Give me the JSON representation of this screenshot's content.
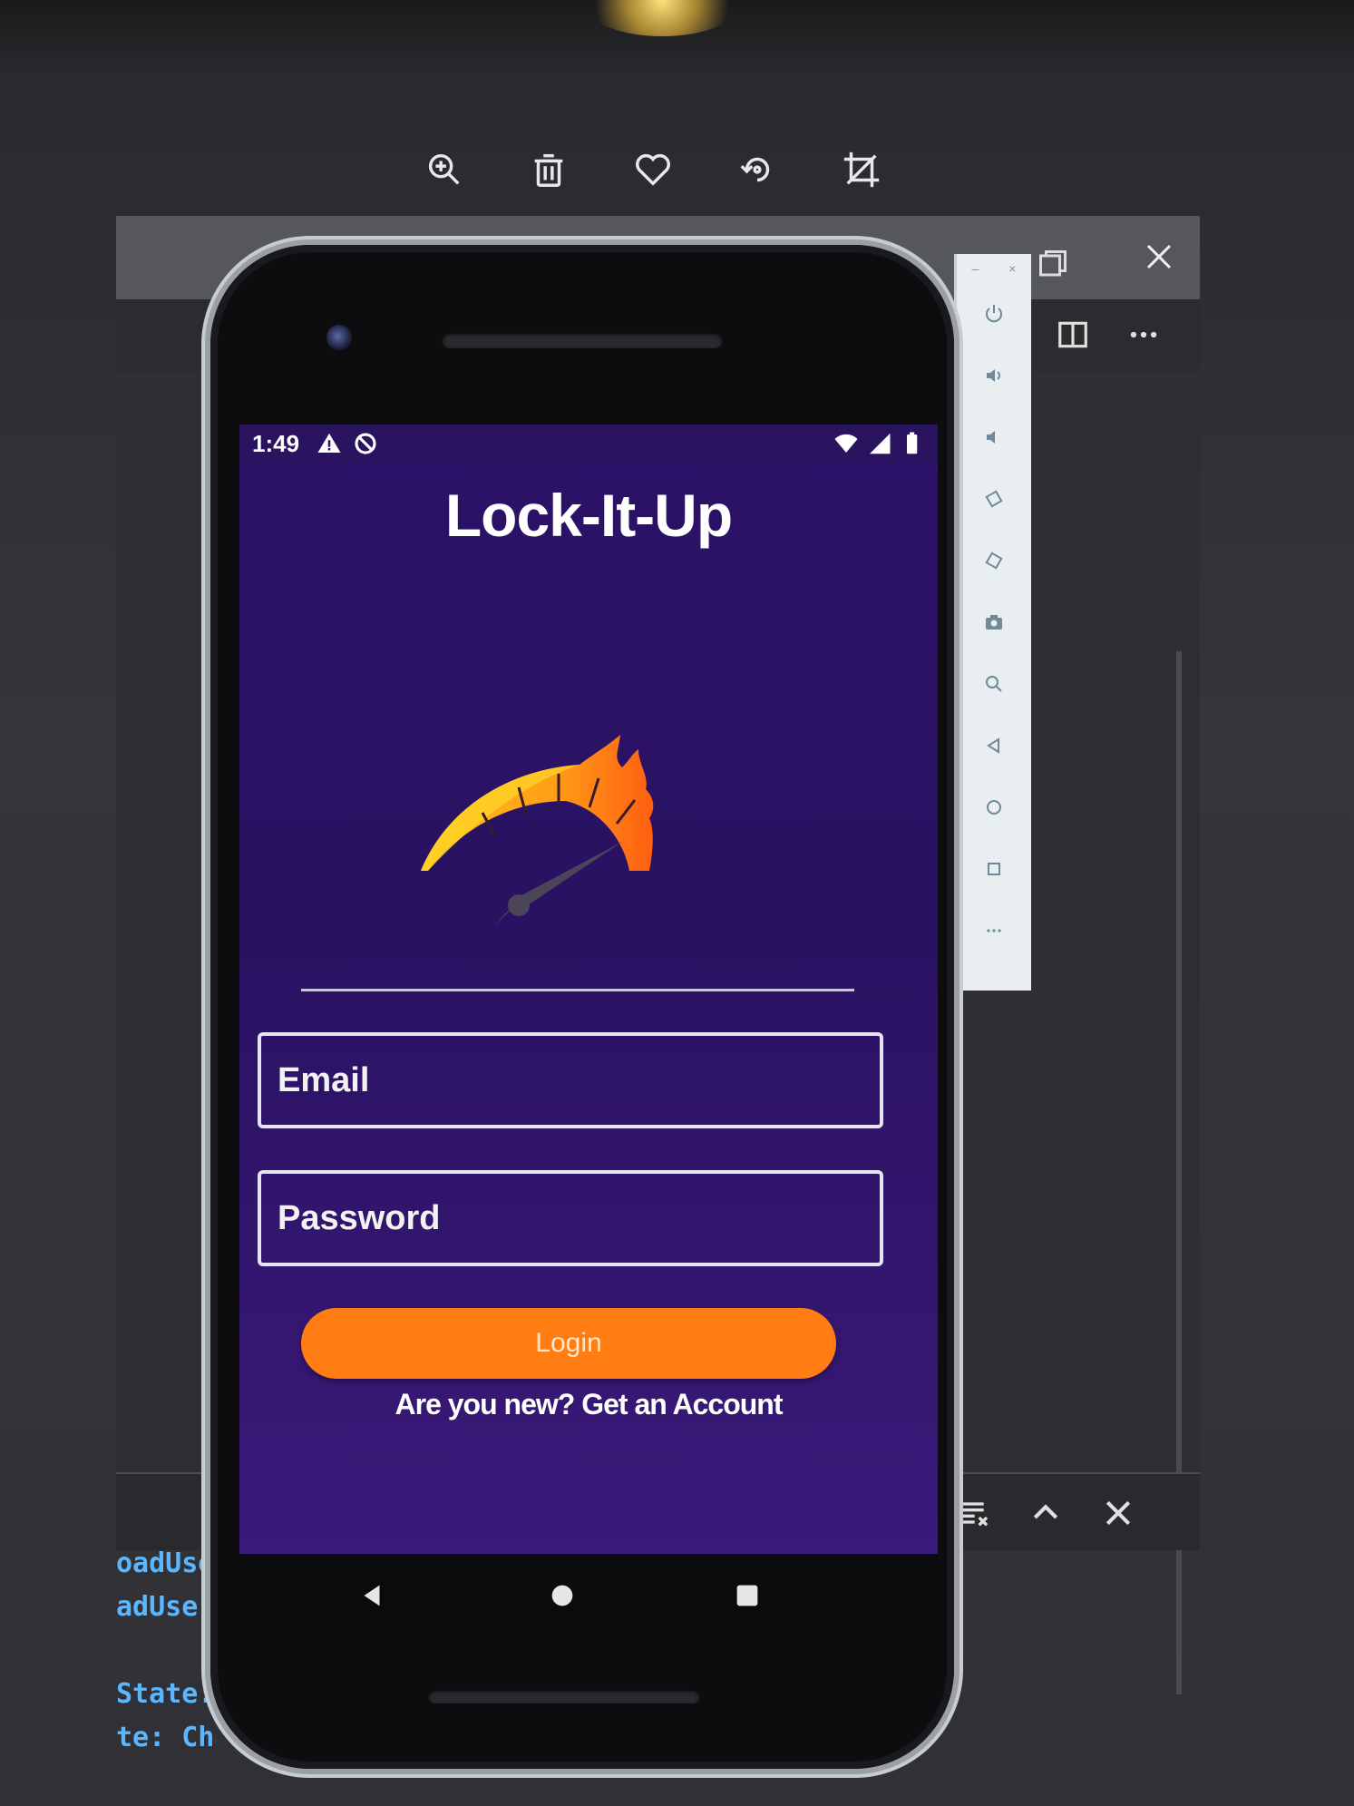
{
  "viewer_toolbar": {
    "icons": [
      "zoom-in-icon",
      "trash-icon",
      "heart-icon",
      "rotate-icon",
      "crop-icon"
    ]
  },
  "emulator": {
    "window_icons": [
      "close-icon",
      "maximize-icon"
    ],
    "side_panel_icons": [
      "power-icon",
      "volume-up-icon",
      "volume-down-icon",
      "rotate-left-icon",
      "rotate-right-icon",
      "camera-icon",
      "zoom-icon",
      "back-icon",
      "home-icon",
      "overview-icon",
      "more-icon"
    ]
  },
  "console": {
    "lines": [
      "oadUse",
      "adUser",
      "",
      "State:",
      "te: Cha"
    ]
  },
  "statusbar": {
    "time": "1:49"
  },
  "app": {
    "title": "Lock-It-Up",
    "email_placeholder": "Email",
    "password_placeholder": "Password",
    "login_label": "Login",
    "register_link": "Are you new? Get an Account"
  },
  "colors": {
    "background_purple": "#2c1268",
    "login_button": "#ff7d12",
    "flame_yellow": "#ffc21a",
    "flame_orange": "#ff6a12"
  }
}
